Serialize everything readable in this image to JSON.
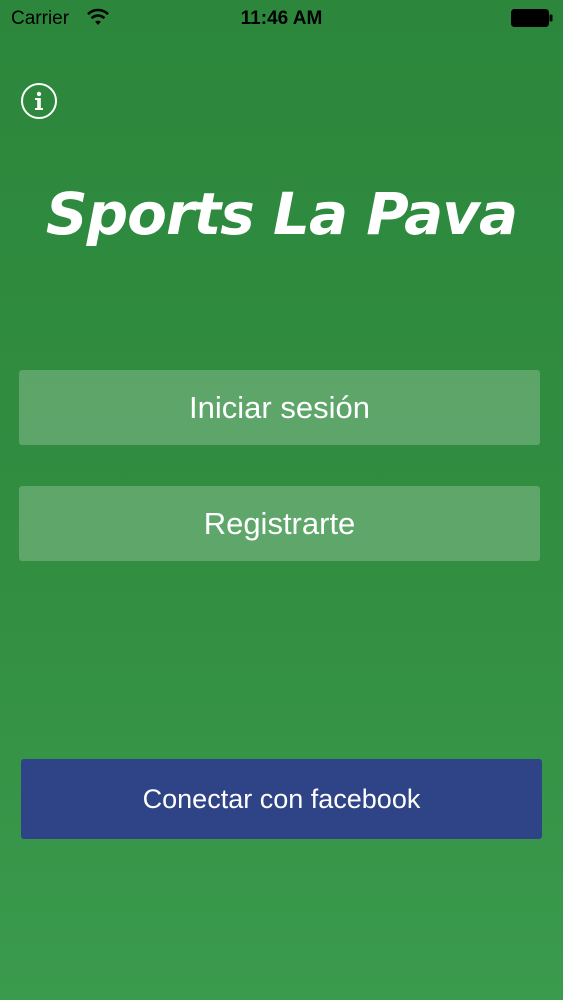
{
  "status_bar": {
    "carrier": "Carrier",
    "time": "11:46 AM",
    "wifi_icon": "wifi-icon",
    "battery_icon": "battery-icon"
  },
  "info_button": {
    "icon": "info-icon"
  },
  "logo": {
    "text": "Sports La Pava"
  },
  "buttons": {
    "login_label": "Iniciar sesión",
    "register_label": "Registrarte",
    "facebook_label": "Conectar con facebook"
  },
  "colors": {
    "background": "#318d40",
    "facebook": "#2f4486",
    "text": "#ffffff"
  }
}
